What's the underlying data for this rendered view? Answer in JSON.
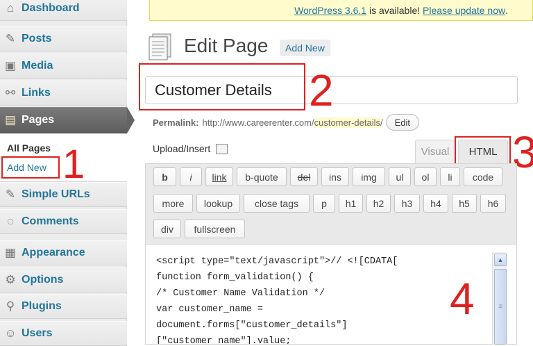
{
  "sidebar": {
    "items": [
      {
        "label": "Dashboard",
        "icon": "home-icon"
      },
      {
        "label": "Posts",
        "icon": "pushpin-icon"
      },
      {
        "label": "Media",
        "icon": "media-icon"
      },
      {
        "label": "Links",
        "icon": "link-icon"
      },
      {
        "label": "Pages",
        "icon": "pages-icon"
      },
      {
        "label": "Simple URLs",
        "icon": "pushpin-icon"
      },
      {
        "label": "Comments",
        "icon": "comment-icon"
      },
      {
        "label": "Appearance",
        "icon": "appearance-icon"
      },
      {
        "label": "Options",
        "icon": "gear-icon"
      },
      {
        "label": "Plugins",
        "icon": "plugin-icon"
      },
      {
        "label": "Users",
        "icon": "users-icon"
      }
    ],
    "submenu": {
      "all_pages": "All Pages",
      "add_new": "Add New"
    }
  },
  "notice": {
    "version_link": "WordPress 3.6.1",
    "middle_text": " is available! ",
    "update_link": "Please update now",
    "end": "."
  },
  "header": {
    "title": "Edit Page",
    "add_new": "Add New"
  },
  "post": {
    "title": "Customer Details",
    "permalink_label": "Permalink:",
    "permalink_base": "http://www.careerenter.com/",
    "permalink_slug": "customer-details",
    "permalink_end": "/",
    "edit_button": "Edit"
  },
  "editor": {
    "upload_insert": "Upload/Insert",
    "tabs": {
      "visual": "Visual",
      "html": "HTML"
    },
    "quicktags": [
      "b",
      "i",
      "link",
      "b-quote",
      "del",
      "ins",
      "img",
      "ul",
      "ol",
      "li",
      "code",
      "more",
      "lookup",
      "close tags",
      "p",
      "h1",
      "h2",
      "h3",
      "h4",
      "h5",
      "h6",
      "div",
      "fullscreen"
    ],
    "code_lines": [
      "<script type=\"text/javascript\">// <![CDATA[",
      "function form_validation() {",
      "/* Customer Name Validation */",
      "var customer_name =",
      "document.forms[\"customer_details\"]",
      "[\"customer_name\"].value;"
    ]
  },
  "annotations": [
    "1",
    "2",
    "3",
    "4"
  ],
  "colors": {
    "accent": "#21759b",
    "annotation": "#e02020",
    "active_menu": "#646464",
    "notice_bg": "#fffbcc"
  }
}
